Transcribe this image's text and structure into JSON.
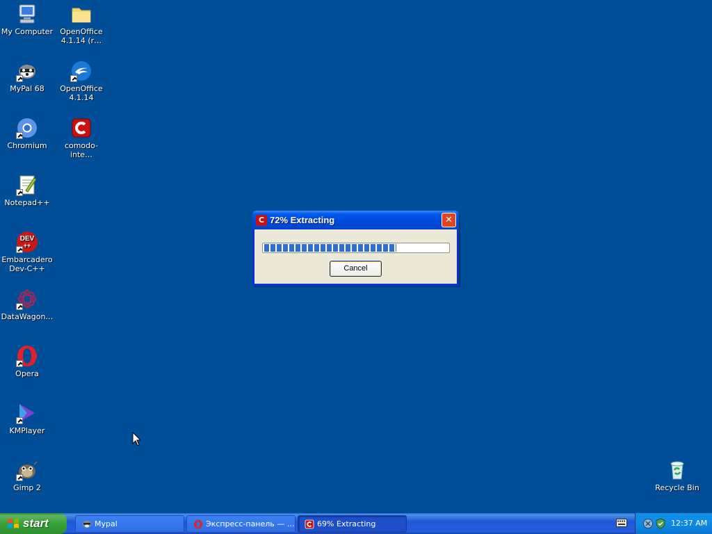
{
  "desktop": {
    "icons": [
      {
        "label": "My Computer",
        "icon": "my-computer-icon"
      },
      {
        "label": "OpenOffice 4.1.14 (r…",
        "icon": "folder-icon"
      },
      {
        "label": "MyPal 68",
        "icon": "mypal-icon"
      },
      {
        "label": "OpenOffice 4.1.14",
        "icon": "openoffice-icon"
      },
      {
        "label": "Chromium",
        "icon": "chromium-icon"
      },
      {
        "label": "comodo-inte…",
        "icon": "comodo-icon"
      },
      {
        "label": "Notepad++",
        "icon": "notepadpp-icon"
      },
      {
        "label": "Embarcadero Dev-C++",
        "icon": "devcpp-icon"
      },
      {
        "label": "DataWagon…",
        "icon": "datawagon-icon"
      },
      {
        "label": "Opera",
        "icon": "opera-icon"
      },
      {
        "label": "KMPlayer",
        "icon": "kmplayer-icon"
      },
      {
        "label": "Gimp 2",
        "icon": "gimp-icon"
      },
      {
        "label": "Recycle Bin",
        "icon": "recycle-bin-icon"
      }
    ],
    "devcpp_badge": "DEV",
    "devcpp_badge2": "++"
  },
  "dialog": {
    "title": "72% Extracting",
    "title_icon_letter": "C",
    "close_glyph": "✕",
    "progress_fraction": 0.72,
    "cancel_label": "Cancel"
  },
  "taskbar": {
    "start_label": "start",
    "tasks": [
      {
        "label": "Mypal",
        "icon": "mypal-icon",
        "active": false
      },
      {
        "label": "Экспресс-панель — …",
        "icon": "opera-icon",
        "active": false
      },
      {
        "label": "69% Extracting",
        "icon": "comodo-icon",
        "active": true
      }
    ],
    "clock": "12:37 AM"
  },
  "colors": {
    "desktop_bg": "#004e98",
    "titlebar": "#0054e3",
    "progress_fill": "#2e6fd3",
    "comodo_red": "#cc1010",
    "opera_red": "#e0202a"
  }
}
